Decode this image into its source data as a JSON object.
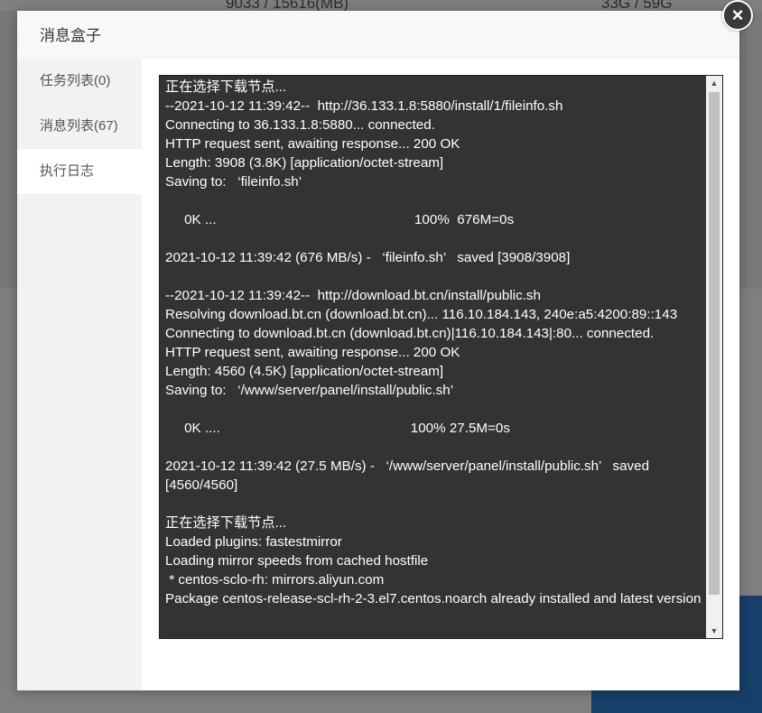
{
  "background": {
    "memory_text": "9033 / 15616(MB)",
    "disk_text": "33G / 59G"
  },
  "dialog": {
    "title": "消息盒子",
    "close_symbol": "×"
  },
  "sidebar": {
    "items": [
      {
        "label": "任务列表(0)",
        "active": false
      },
      {
        "label": "消息列表(67)",
        "active": false
      },
      {
        "label": "执行日志",
        "active": true
      }
    ]
  },
  "log": {
    "lines": [
      "正在选择下载节点...",
      "--2021-10-12 11:39:42--  http://36.133.1.8:5880/install/1/fileinfo.sh",
      "Connecting to 36.133.1.8:5880... connected.",
      "HTTP request sent, awaiting response... 200 OK",
      "Length: 3908 (3.8K) [application/octet-stream]",
      "Saving to:   ‘fileinfo.sh’",
      "",
      "     0K ...                                                    100%  676M=0s",
      "",
      "2021-10-12 11:39:42 (676 MB/s) -   ‘fileinfo.sh’   saved [3908/3908]",
      "",
      "--2021-10-12 11:39:42--  http://download.bt.cn/install/public.sh",
      "Resolving download.bt.cn (download.bt.cn)... 116.10.184.143, 240e:a5:4200:89::143",
      "Connecting to download.bt.cn (download.bt.cn)|116.10.184.143|:80... connected.",
      "HTTP request sent, awaiting response... 200 OK",
      "Length: 4560 (4.5K) [application/octet-stream]",
      "Saving to:   ‘/www/server/panel/install/public.sh’",
      "",
      "     0K ....                                                  100% 27.5M=0s",
      "",
      "2021-10-12 11:39:42 (27.5 MB/s) -   ‘/www/server/panel/install/public.sh’   saved [4560/4560]",
      "",
      "正在选择下载节点...",
      "Loaded plugins: fastestmirror",
      "Loading mirror speeds from cached hostfile",
      " * centos-sclo-rh: mirrors.aliyun.com",
      "Package centos-release-scl-rh-2-3.el7.centos.noarch already installed and latest version"
    ]
  },
  "scrollbar": {
    "up_arrow": "▲",
    "down_arrow": "▼"
  }
}
